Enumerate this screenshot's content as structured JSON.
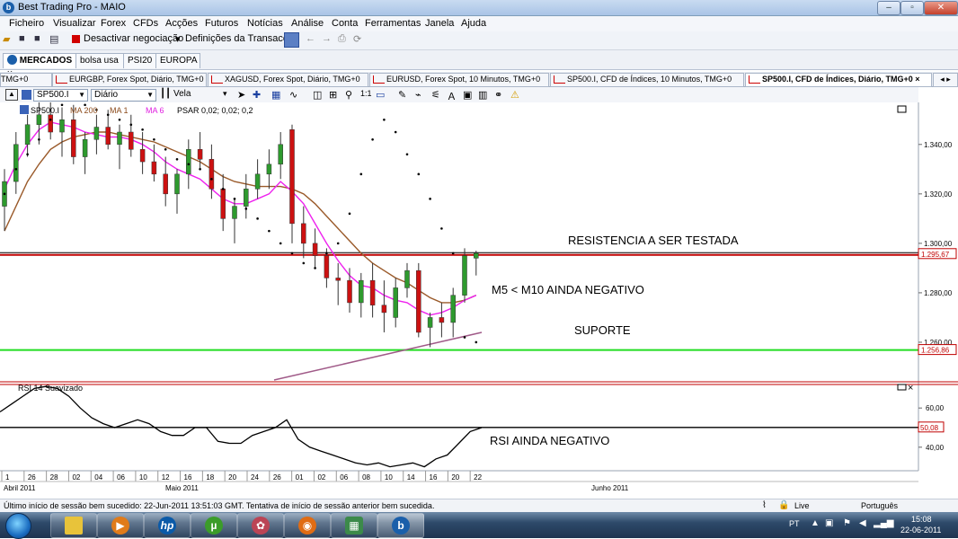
{
  "window": {
    "title": "Best Trading Pro - MAIO",
    "logo": "b"
  },
  "menu": [
    "Ficheiro",
    "Visualizar",
    "Forex",
    "CFDs",
    "Acções",
    "Futuros",
    "Notícias",
    "Análise",
    "Conta",
    "Ferramentas",
    "Janela",
    "Ajuda"
  ],
  "toolbar": {
    "deactivate_label": "Desactivar negociação",
    "settings_label": "Definições da Transacção"
  },
  "market_tabs": [
    {
      "label": "MERCADOS",
      "close": "×"
    },
    {
      "label": "bolsa usa"
    },
    {
      "label": "PSI20"
    },
    {
      "label": "EUROPA"
    }
  ],
  "chart_tabs": [
    {
      "label": "TMG+0"
    },
    {
      "label": "EURGBP, Forex Spot, Diário, TMG+0"
    },
    {
      "label": "XAGUSD, Forex Spot, Diário, TMG+0"
    },
    {
      "label": "EURUSD, Forex Spot, 10 Minutos, TMG+0"
    },
    {
      "label": "SP500.I, CFD de Índices, 10 Minutos, TMG+0"
    },
    {
      "label": "SP500.I, CFD de Índices, Diário, TMG+0 ×",
      "active": true
    }
  ],
  "chart_toolbar": {
    "symbol": "SP500.I",
    "period": "Diário",
    "chart_type": "Vela"
  },
  "indicator_labels": {
    "symbol": "SP500.I",
    "ma1": "MA 200",
    "ma2": "MA 1",
    "ma3": "MA 6",
    "psar": "PSAR 0,02; 0,02; 0,2"
  },
  "rsi_label": "RSI 14 Suavizado",
  "annotations": {
    "resistance": "RESISTENCIA   A SER TESTADA",
    "ma_cross": "M5 < M10 AINDA NEGATIVO",
    "support": "SUPORTE",
    "rsi": "RSI AINDA NEGATIVO"
  },
  "chart_data": {
    "type": "candlestick",
    "price_axis": {
      "ticks": [
        "1.340,00",
        "1.320,00",
        "1.300,00",
        "1.280,00",
        "1.260,00"
      ],
      "range": [
        1244,
        1357
      ]
    },
    "resistance_value": "1.295,67",
    "support_value": "1.256,86",
    "resistance": 1295.67,
    "support": 1256.86,
    "rsi_axis": {
      "ticks": [
        "60,00",
        "40,00"
      ],
      "range": [
        28,
        72
      ]
    },
    "rsi_level": "50,08",
    "date_labels": [
      "1",
      "26",
      "28",
      "02",
      "04",
      "06",
      "10",
      "12",
      "16",
      "18",
      "20",
      "24",
      "26",
      "01",
      "02",
      "06",
      "08",
      "10",
      "14",
      "16",
      "20",
      "22"
    ],
    "month_labels": [
      "Abril 2011",
      "Maio 2011",
      "Junho 2011"
    ],
    "candles": [
      {
        "o": 1315,
        "h": 1330,
        "l": 1305,
        "c": 1325
      },
      {
        "o": 1325,
        "h": 1345,
        "l": 1320,
        "c": 1340
      },
      {
        "o": 1340,
        "h": 1352,
        "l": 1335,
        "c": 1348
      },
      {
        "o": 1348,
        "h": 1358,
        "l": 1340,
        "c": 1352
      },
      {
        "o": 1352,
        "h": 1360,
        "l": 1342,
        "c": 1345
      },
      {
        "o": 1345,
        "h": 1355,
        "l": 1335,
        "c": 1350
      },
      {
        "o": 1350,
        "h": 1356,
        "l": 1332,
        "c": 1335
      },
      {
        "o": 1335,
        "h": 1345,
        "l": 1328,
        "c": 1342
      },
      {
        "o": 1342,
        "h": 1352,
        "l": 1336,
        "c": 1347
      },
      {
        "o": 1347,
        "h": 1354,
        "l": 1338,
        "c": 1340
      },
      {
        "o": 1340,
        "h": 1348,
        "l": 1330,
        "c": 1345
      },
      {
        "o": 1345,
        "h": 1352,
        "l": 1335,
        "c": 1338
      },
      {
        "o": 1338,
        "h": 1345,
        "l": 1328,
        "c": 1333
      },
      {
        "o": 1333,
        "h": 1340,
        "l": 1325,
        "c": 1328
      },
      {
        "o": 1328,
        "h": 1335,
        "l": 1315,
        "c": 1320
      },
      {
        "o": 1320,
        "h": 1330,
        "l": 1312,
        "c": 1328
      },
      {
        "o": 1328,
        "h": 1342,
        "l": 1322,
        "c": 1338
      },
      {
        "o": 1338,
        "h": 1345,
        "l": 1330,
        "c": 1334
      },
      {
        "o": 1334,
        "h": 1340,
        "l": 1318,
        "c": 1322
      },
      {
        "o": 1322,
        "h": 1328,
        "l": 1305,
        "c": 1310
      },
      {
        "o": 1310,
        "h": 1318,
        "l": 1300,
        "c": 1315
      },
      {
        "o": 1315,
        "h": 1328,
        "l": 1310,
        "c": 1322
      },
      {
        "o": 1322,
        "h": 1334,
        "l": 1318,
        "c": 1328
      },
      {
        "o": 1328,
        "h": 1338,
        "l": 1322,
        "c": 1332
      },
      {
        "o": 1332,
        "h": 1345,
        "l": 1326,
        "c": 1340
      },
      {
        "o": 1346,
        "h": 1348,
        "l": 1300,
        "c": 1308
      },
      {
        "o": 1308,
        "h": 1315,
        "l": 1294,
        "c": 1300
      },
      {
        "o": 1300,
        "h": 1306,
        "l": 1290,
        "c": 1295
      },
      {
        "o": 1295,
        "h": 1298,
        "l": 1282,
        "c": 1286
      },
      {
        "o": 1286,
        "h": 1292,
        "l": 1275,
        "c": 1285
      },
      {
        "o": 1285,
        "h": 1290,
        "l": 1272,
        "c": 1276
      },
      {
        "o": 1276,
        "h": 1288,
        "l": 1270,
        "c": 1285
      },
      {
        "o": 1285,
        "h": 1292,
        "l": 1270,
        "c": 1275
      },
      {
        "o": 1275,
        "h": 1285,
        "l": 1264,
        "c": 1272
      },
      {
        "o": 1270,
        "h": 1286,
        "l": 1266,
        "c": 1282
      },
      {
        "o": 1282,
        "h": 1292,
        "l": 1278,
        "c": 1289
      },
      {
        "o": 1289,
        "h": 1292,
        "l": 1262,
        "c": 1264
      },
      {
        "o": 1266,
        "h": 1272,
        "l": 1258,
        "c": 1270
      },
      {
        "o": 1270,
        "h": 1276,
        "l": 1262,
        "c": 1268
      },
      {
        "o": 1268,
        "h": 1282,
        "l": 1262,
        "c": 1279
      },
      {
        "o": 1279,
        "h": 1298,
        "l": 1276,
        "c": 1295
      },
      {
        "o": 1294,
        "h": 1297,
        "l": 1287,
        "c": 1296
      }
    ],
    "ma_fast": [
      1322,
      1332,
      1340,
      1346,
      1349,
      1348,
      1347,
      1345,
      1344,
      1343,
      1343,
      1342,
      1340,
      1337,
      1333,
      1330,
      1328,
      1326,
      1322,
      1318,
      1316,
      1316,
      1318,
      1320,
      1325,
      1321,
      1316,
      1308,
      1300,
      1293,
      1287,
      1283,
      1282,
      1279,
      1277,
      1276,
      1273,
      1271,
      1272,
      1274,
      1277,
      1279
    ],
    "ma_slow": [
      1305,
      1315,
      1325,
      1332,
      1338,
      1341,
      1343,
      1344,
      1345,
      1345,
      1344,
      1343,
      1342,
      1341,
      1339,
      1337,
      1335,
      1333,
      1330,
      1327,
      1325,
      1324,
      1323,
      1323,
      1323,
      1322,
      1320,
      1316,
      1311,
      1306,
      1301,
      1296,
      1292,
      1289,
      1286,
      1284,
      1281,
      1278,
      1276,
      1276,
      1277,
      1279
    ],
    "psar": [
      1320,
      1330,
      1336,
      1342,
      1350,
      1356,
      1358,
      1356,
      1354,
      1352,
      1350,
      1348,
      1346,
      1342,
      1338,
      1334,
      1332,
      1330,
      1326,
      1322,
      1318,
      1314,
      1310,
      1305,
      1300,
      1296,
      1292,
      1290,
      1296,
      1300,
      1312,
      1328,
      1342,
      1350,
      1345,
      1336,
      1328,
      1318,
      1306,
      1296,
      1262,
      1260
    ],
    "rsi": [
      58,
      62,
      66,
      70,
      71,
      70,
      66,
      60,
      55,
      52,
      50,
      52,
      54,
      52,
      48,
      46,
      46,
      50,
      50,
      43,
      42,
      42,
      46,
      48,
      50,
      54,
      44,
      40,
      38,
      36,
      34,
      32,
      31,
      32,
      30,
      31,
      32,
      30,
      34,
      36,
      42,
      48,
      50
    ]
  },
  "status_bar": {
    "message": "Último início de sessão bem sucedido: 22-Jun-2011 13:51:03 GMT. Tentativa de início de sessão anterior bem sucedida.",
    "connection": "Live",
    "language": "Português"
  },
  "taskbar": {
    "app_icons": [
      "explorer-icon",
      "media-player-icon",
      "hp-icon",
      "utorrent-icon",
      "network-icon",
      "firefox-icon",
      "control-panel-icon",
      "best-trading-icon"
    ],
    "tray_lang": "PT",
    "time": "15:08",
    "date": "22-06-2011"
  }
}
